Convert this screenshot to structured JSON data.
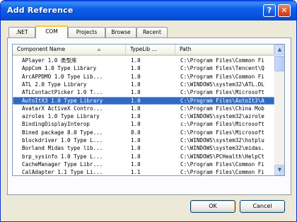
{
  "window": {
    "title": "Add Reference",
    "help_glyph": "?",
    "close_glyph": "✕"
  },
  "tabs": [
    {
      "label": ".NET"
    },
    {
      "label": "COM",
      "active": true
    },
    {
      "label": "Projects"
    },
    {
      "label": "Browse"
    },
    {
      "label": "Recent"
    }
  ],
  "list": {
    "columns": [
      "Component Name",
      "TypeLib ...",
      "Path"
    ],
    "sorted_by": "Component Name",
    "rows": [
      {
        "name": "APlayer 1.0 类型库",
        "version": "1.0",
        "path": "C:\\Program Files\\Common Fi"
      },
      {
        "name": "AppCom 1.0 Type Library",
        "version": "1.0",
        "path": "C:\\Program Files\\Tencent\\Q"
      },
      {
        "name": "ArcAPPDMO 1.0 Type Lib...",
        "version": "1.0",
        "path": "C:\\Program Files\\Common Fi"
      },
      {
        "name": "ATL 2.0 Type Library",
        "version": "1.0",
        "path": "C:\\WINDOWS\\system32\\ATL.DL"
      },
      {
        "name": "ATLContactPicker 1.0 T...",
        "version": "1.0",
        "path": "C:\\Program Files\\Microsoft"
      },
      {
        "name": "AutoItX3 1.0 Type Library",
        "version": "1.0",
        "path": "C:\\Program Files\\AutoIt3\\A",
        "selected": true
      },
      {
        "name": "AvatarX ActiveX Contro...",
        "version": "1.0",
        "path": "C:\\Program Files\\China Mob"
      },
      {
        "name": "azroles 1.0 Type Library",
        "version": "1.0",
        "path": "C:\\WINDOWS\\system32\\azrole"
      },
      {
        "name": "BindingDisplayInterop",
        "version": "1.0",
        "path": "c:\\Program Files\\Microsoft"
      },
      {
        "name": "Bined package 8.0 Type...",
        "version": "8.0",
        "path": "C:\\Program Files\\Microsoft"
      },
      {
        "name": "blockdriver 1.0 Type L...",
        "version": "1.0",
        "path": "C:\\WINDOWS\\system32\\hotplu"
      },
      {
        "name": "Borland Midas type lib...",
        "version": "1.0",
        "path": "C:\\WINDOWS\\system32\\midas."
      },
      {
        "name": "brp_sysinfo 1.0 Type L...",
        "version": "1.0",
        "path": "C:\\WINDOWS\\PCHealth\\HelpCt"
      },
      {
        "name": "CacheManager Type Libr...",
        "version": "1.0",
        "path": "C:\\Program Files\\Common Fi"
      },
      {
        "name": "CalAdapter 1.1 Type Li...",
        "version": "1.1",
        "path": "C:\\Program Files\\Common Fi"
      }
    ]
  },
  "scrollbar": {
    "up_glyph": "▲",
    "down_glyph": "▼"
  },
  "buttons": {
    "ok": "OK",
    "cancel": "Cancel"
  }
}
